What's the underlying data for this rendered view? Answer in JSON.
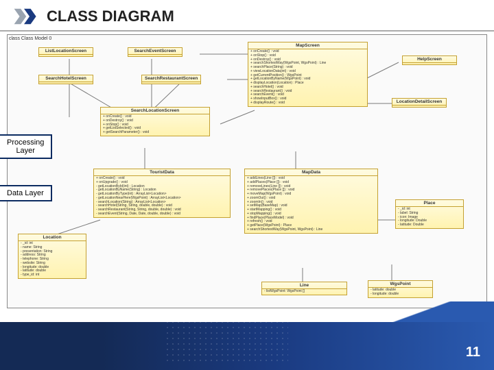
{
  "header": {
    "title": "CLASS DIAGRAM"
  },
  "canvas_label": "class Class Model 0",
  "callouts": {
    "processing": "Processing\nLayer",
    "data": "Data Layer"
  },
  "classes": {
    "listLocation": {
      "name": "ListLocationScreen",
      "methods": []
    },
    "searchEvent": {
      "name": "SearchEventScreen",
      "methods": []
    },
    "searchHotel": {
      "name": "SearchHotelScreen",
      "methods": []
    },
    "searchRest": {
      "name": "SearchRestaurantScreen",
      "methods": []
    },
    "help": {
      "name": "HelpScreen",
      "methods": []
    },
    "locDetail": {
      "name": "LocationDetailScreen",
      "methods": []
    },
    "mapScreen": {
      "name": "MapScreen",
      "methods": [
        "+ onCreate() : void",
        "+ onStop() : void",
        "+ onDestroy() : void",
        "+ searchShortestWay(WgsPoint, WgsPoint) : Line",
        "+ searchPlace(String) : void",
        "+ viewLocationData(int) : void",
        "+ getCurrentPosition() : WgsPoint",
        "+ getLocationByName(WgsPoint) : void",
        "+ displayLocation(Location) : Place",
        "+ searchHotel() : void",
        "+ searchRestaurant() : void",
        "+ searchEvent() : void",
        "+ showInputBox() : void",
        "+ displayRoute() : void"
      ]
    },
    "searchLoc": {
      "name": "SearchLocationScreen",
      "methods": [
        "+ onCreate() : void",
        "+ onDestroy() : void",
        "+ onStop() : void",
        "+ getListSelected() : void",
        "+ getSearchParameter() : void"
      ]
    },
    "touristData": {
      "name": "TouristData",
      "methods": [
        "+ onCreate() : void",
        "+ onUpgrade() : void",
        "- getLocationById(int) : Location",
        "- getLocationByName(String) : Location",
        "- getLocationByType(int) : ArrayList<Location>",
        "- getLocationNearHere(WgsPoint) : ArrayList<Location>",
        "- searchLocation(String) : ArrayList<Location>",
        "- searchHotel(String, String, double, double) : void",
        "- searchRestaurant(String, String, double, double) : void",
        "- searchEvent(String, Date, Date, double, double) : void"
      ]
    },
    "mapData": {
      "name": "MapData",
      "methods": [
        "+ addLines(Line []) : void",
        "+ addPlaces(Place []) : void",
        "+ removeLines(Line []) : void",
        "+ removePlaces(Place []) : void",
        "+ moveMap(WgsPoint) : void",
        "+ zoomOut() : void",
        "+ zoomIn() : void",
        "+ setMap(BaseMap) : void",
        "+ startMapping() : void",
        "+ stopMapping() : void",
        "+ findPlace(PlaceModel) : void",
        "+ refresh() : void",
        "+ getPlace(WgsPoint) : Place",
        "+ searchShortestWay(WgsPoint, WgsPoint) : Line"
      ]
    },
    "location": {
      "name": "Location",
      "attrs": [
        "- _id: int",
        "- name: String",
        "- presentation: String",
        "- address: String",
        "- telephone: String",
        "- website: String",
        "- longitude: double",
        "- latitude: double",
        "- type_id: int"
      ]
    },
    "place": {
      "name": "Place",
      "attrs": [
        "- _id: int",
        "- label: String",
        "- icon: Image",
        "- longitude: Double",
        "- latitude: Double"
      ]
    },
    "line": {
      "name": "Line",
      "attrs": [
        "- listWgsPoint: WgsPoint []"
      ]
    },
    "wgs": {
      "name": "WgsPoint",
      "attrs": [
        "- latitude: double",
        "- longitude: double"
      ]
    }
  },
  "page_number": "11"
}
